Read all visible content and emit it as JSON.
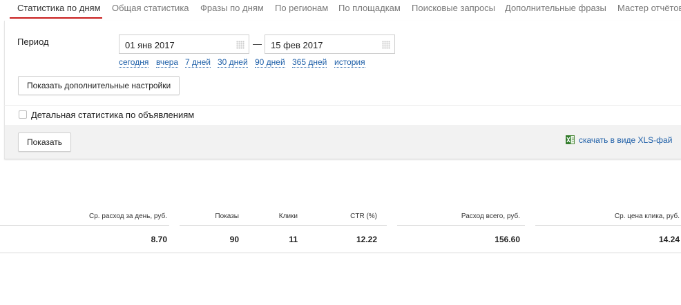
{
  "tabs": [
    {
      "label": "Статистика по дням",
      "active": true
    },
    {
      "label": "Общая статистика"
    },
    {
      "label": "Фразы по дням"
    },
    {
      "label": "По регионам"
    },
    {
      "label": "По площадкам"
    },
    {
      "label": "Поисковые запросы"
    },
    {
      "label": "Дополнительные фразы"
    },
    {
      "label": "Мастер отчётов"
    }
  ],
  "filter": {
    "period_label": "Период",
    "date_from": "01 янв 2017",
    "date_separator": "—",
    "date_to": "15 фев 2017",
    "quick_links": [
      "сегодня",
      "вчера",
      "7 дней",
      "30 дней",
      "90 дней",
      "365 дней",
      "история"
    ],
    "more_settings_label": "Показать дополнительные настройки",
    "detailed_checkbox_label": "Детальная статистика по объявлениям",
    "detailed_checked": false,
    "show_button_label": "Показать",
    "download_link": "скачать в виде XLS-фай"
  },
  "table": {
    "headers": [
      "Ср. расход за день, руб.",
      "Показы",
      "Клики",
      "CTR (%)",
      "Расход всего, руб.",
      "Ср. цена клика, руб."
    ],
    "row": [
      "8.70",
      "90",
      "11",
      "12.22",
      "156.60",
      "14.24"
    ]
  },
  "colors": {
    "accent": "#c81c1c",
    "link": "#1e5fa8",
    "band": "#f2f2f2"
  }
}
